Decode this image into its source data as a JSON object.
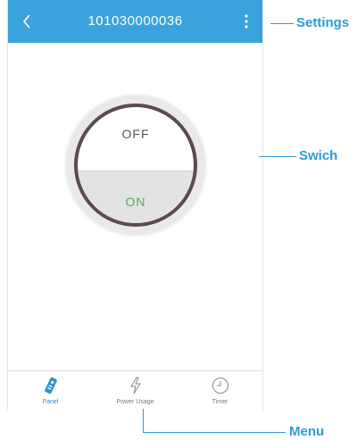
{
  "header": {
    "title": "101030000036",
    "back_icon": "chevron-left-icon",
    "menu_icon": "more-vertical-icon"
  },
  "switch": {
    "off_label": "OFF",
    "on_label": "ON"
  },
  "tabs": [
    {
      "label": "Panel",
      "icon": "remote-icon",
      "active": true
    },
    {
      "label": "Power Usage",
      "icon": "lightning-icon",
      "active": false
    },
    {
      "label": "Timer",
      "icon": "clock-icon",
      "active": false
    }
  ],
  "annotations": {
    "settings": "Settings",
    "switch": "Swich",
    "menu": "Menu"
  },
  "colors": {
    "header": "#3aa3de",
    "accent": "#2e9ad7",
    "on": "#4caf50"
  }
}
